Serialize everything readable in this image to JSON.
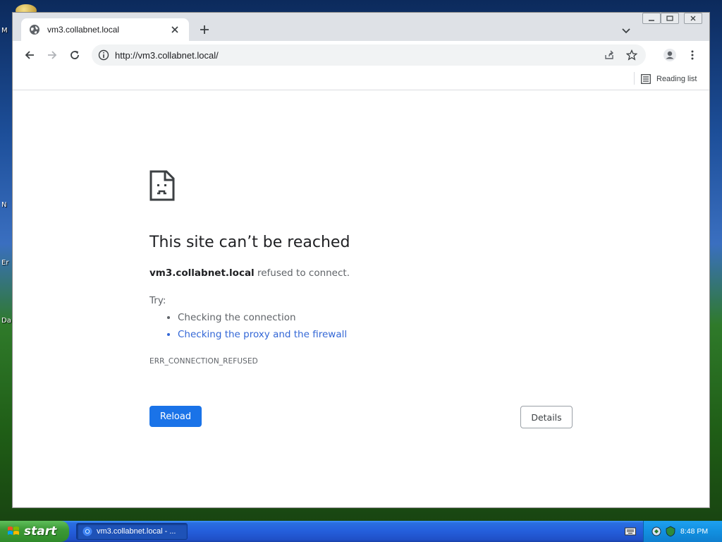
{
  "desktop": {
    "labels": [
      "M",
      "N",
      "Er",
      "Da"
    ]
  },
  "browser": {
    "tab_title": "vm3.collabnet.local",
    "url": "http://vm3.collabnet.local/",
    "reading_list_label": "Reading list"
  },
  "error_page": {
    "title": "This site can’t be reached",
    "host": "vm3.collabnet.local",
    "description_suffix": " refused to connect.",
    "try_label": "Try:",
    "suggestions": [
      "Checking the connection",
      "Checking the proxy and the firewall"
    ],
    "error_code": "ERR_CONNECTION_REFUSED",
    "reload_label": "Reload",
    "details_label": "Details"
  },
  "taskbar": {
    "start_label": "start",
    "task_label": "vm3.collabnet.local - ...",
    "clock": "8:48 PM"
  },
  "colors": {
    "accent": "#1a73e8",
    "link": "#3367d6",
    "taskbar": "#245edb",
    "start": "#3d9a36"
  }
}
